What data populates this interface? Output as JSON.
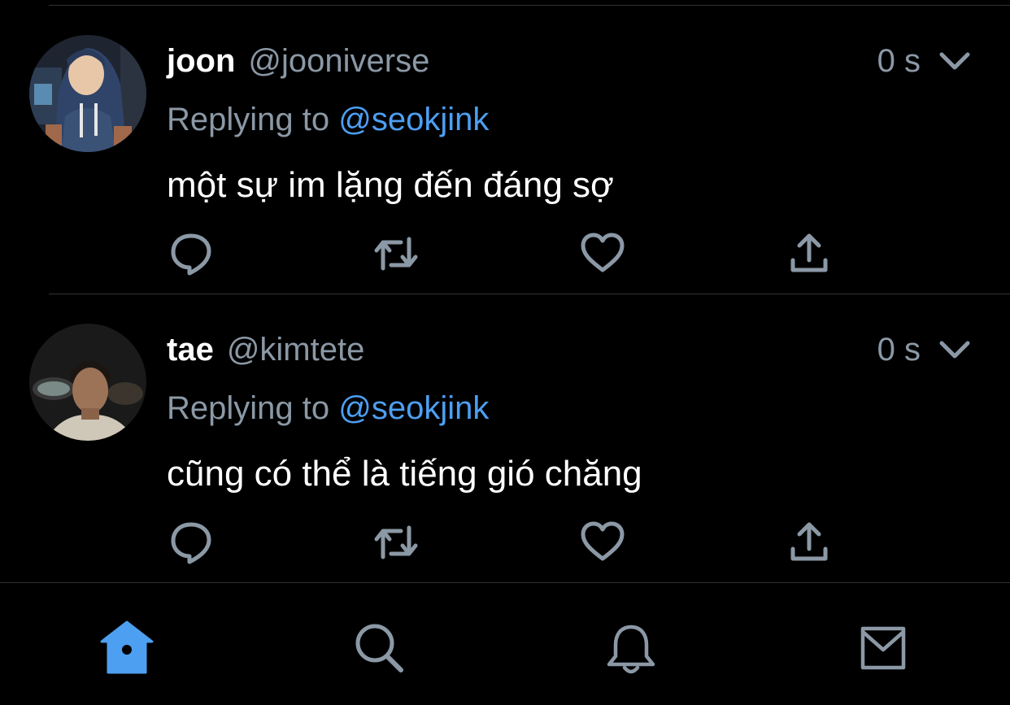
{
  "colors": {
    "background": "#000000",
    "divider": "#2f3336",
    "muted": "#8b98a5",
    "accent": "#4d9ff1",
    "text": "#ffffff"
  },
  "tweets": [
    {
      "name": "joon",
      "handle": "@jooniverse",
      "time": "0 s",
      "reply_prefix": "Replying to",
      "reply_target": "@seokjink",
      "text": "một sự im lặng đến đáng sợ",
      "avatar_icon": "avatar-photo"
    },
    {
      "name": "tae",
      "handle": "@kimtete",
      "time": "0 s",
      "reply_prefix": "Replying to",
      "reply_target": "@seokjink",
      "text": "cũng có thể là tiếng gió chăng",
      "avatar_icon": "avatar-photo"
    }
  ],
  "actions": [
    "reply-icon",
    "retweet-icon",
    "like-icon",
    "share-icon"
  ],
  "tabbar": {
    "tabs": [
      {
        "icon": "home-icon",
        "active": true
      },
      {
        "icon": "search-icon",
        "active": false
      },
      {
        "icon": "notifications-icon",
        "active": false
      },
      {
        "icon": "messages-icon",
        "active": false
      }
    ]
  }
}
